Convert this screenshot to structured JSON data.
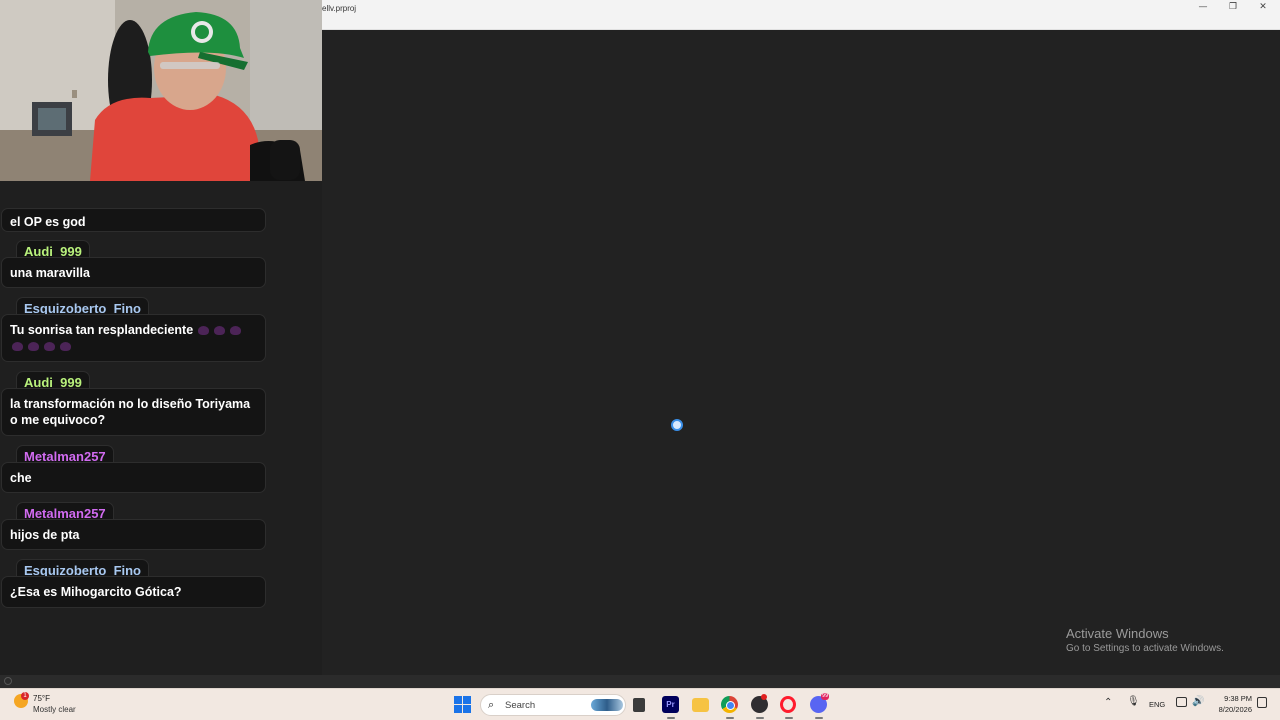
{
  "window": {
    "title": "ellv.prproj",
    "minimize": "—",
    "maximize": "❐",
    "close": "✕"
  },
  "watermark": {
    "title": "Activate Windows",
    "subtitle": "Go to Settings to activate Windows."
  },
  "chat": {
    "messages": [
      {
        "user": "",
        "text": "el OP es god",
        "emotes": 0,
        "color": ""
      },
      {
        "user": "Audi_999",
        "text": "una maravilla",
        "emotes": 0,
        "color": "#b9f27c"
      },
      {
        "user": "Esquizoberto_Fino",
        "text": "Tu sonrisa tan resplandeciente",
        "emotes": 7,
        "color": "#a8c8f0"
      },
      {
        "user": "Audi_999",
        "text": "la transformación no lo diseño Toriyama o me equivoco?",
        "emotes": 0,
        "color": "#b9f27c"
      },
      {
        "user": "Metalman257",
        "text": "che",
        "emotes": 0,
        "color": "#d16bf0"
      },
      {
        "user": "Metalman257",
        "text": "hijos de pta",
        "emotes": 0,
        "color": "#d16bf0"
      },
      {
        "user": "Esquizoberto_Fino",
        "text": "¿Esa es Mihogarcito Gótica?",
        "emotes": 0,
        "color": "#a8c8f0"
      }
    ]
  },
  "taskbar": {
    "weather_temp": "75°F",
    "weather_condition": "Mostly clear",
    "weather_badge": "1",
    "search_placeholder": "Search",
    "premiere_label": "Pr",
    "discord_badge": "99",
    "language": "ENG",
    "time": "9:38 PM",
    "date": "8/20/2026",
    "icons": [
      "windows-start-icon",
      "search-icon",
      "task-view-icon",
      "premiere-pro-icon",
      "file-explorer-icon",
      "chrome-icon",
      "obs-icon",
      "opera-icon",
      "discord-icon"
    ]
  },
  "colors": {
    "accent": "#1a73e8",
    "spinner": "#3a8fe8",
    "chat_bg": "#141414"
  }
}
